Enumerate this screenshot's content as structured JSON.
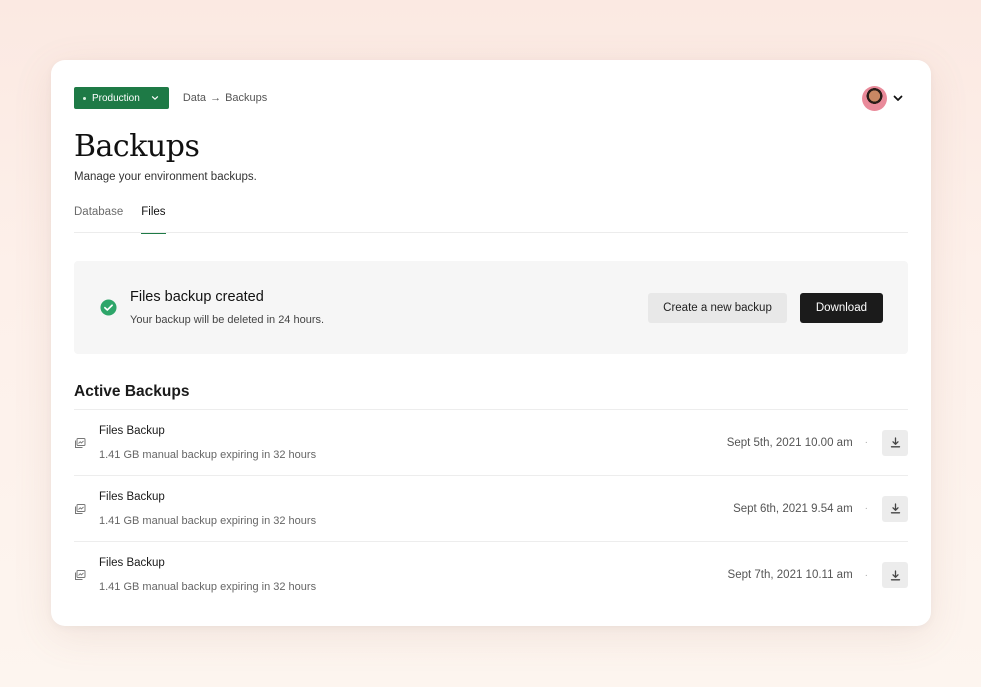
{
  "environment": {
    "label": "Production"
  },
  "breadcrumb": {
    "parent": "Data",
    "arrow": "→",
    "current": "Backups"
  },
  "page": {
    "title": "Backups",
    "subtitle": "Manage your environment backups."
  },
  "tabs": [
    {
      "label": "Database",
      "active": false
    },
    {
      "label": "Files",
      "active": true
    }
  ],
  "alert": {
    "title": "Files backup created",
    "message": "Your backup will be deleted in 24 hours.",
    "create_label": "Create a new backup",
    "download_label": "Download"
  },
  "active_backups": {
    "title": "Active Backups",
    "items": [
      {
        "name": "Files Backup",
        "meta": "1.41 GB manual backup expiring in 32 hours",
        "date": "Sept 5th, 2021 10.00 am",
        "separator": "·"
      },
      {
        "name": "Files Backup",
        "meta": "1.41 GB manual backup expiring in 32 hours",
        "date": "Sept 6th, 2021 9.54 am",
        "separator": "·"
      },
      {
        "name": "Files Backup",
        "meta": "1.41 GB manual backup expiring in 32 hours",
        "date": "Sept 7th, 2021 10.11 am",
        "separator": "·"
      }
    ]
  },
  "colors": {
    "accent_green": "#1e7a46",
    "success_green": "#2ea66a",
    "primary_button": "#1b1b1b",
    "secondary_button": "#e8e8e8"
  },
  "icons": {
    "environment_chevron": "chevron-down-icon",
    "user_chevron": "chevron-down-icon",
    "alert": "check-circle-icon",
    "row": "files-stack-icon",
    "row_action": "download-icon"
  }
}
